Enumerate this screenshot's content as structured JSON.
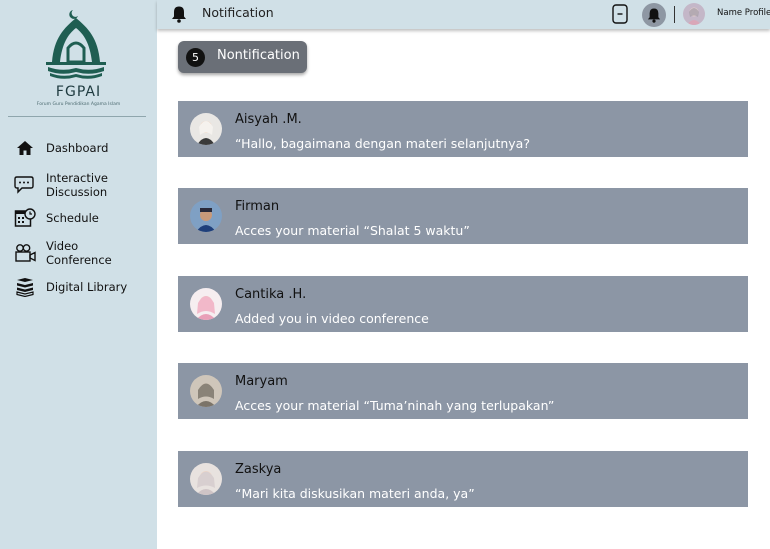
{
  "brand": {
    "name": "FGPAI",
    "tagline": "Forum Guru Pendidikan Agama Islam"
  },
  "sidebar": {
    "items": [
      {
        "label": "Dashboard",
        "icon": "home-icon"
      },
      {
        "label": "Interactive Discussion",
        "icon": "chat-bubbles-icon"
      },
      {
        "label": "Schedule",
        "icon": "calendar-clock-icon"
      },
      {
        "label": "Video Conference",
        "icon": "video-camera-icon"
      },
      {
        "label": "Digital Library",
        "icon": "books-icon"
      }
    ]
  },
  "topbar": {
    "title": "Notification",
    "profile_name": "Name Profile"
  },
  "notifications_button": {
    "count": "5",
    "label": "Nontification"
  },
  "notifications": [
    {
      "name": "Aisyah .M.",
      "message": "“Hallo, bagaimana dengan materi selanjutnya?"
    },
    {
      "name": "Firman",
      "message": "Acces your material “Shalat 5 waktu”"
    },
    {
      "name": "Cantika .H.",
      "message": "Added you in video conference"
    },
    {
      "name": " Maryam",
      "message": "Acces your material “Tuma’ninah yang terlupakan”"
    },
    {
      "name": "Zaskya",
      "message": "“Mari kita diskusikan materi anda, ya”"
    }
  ],
  "colors": {
    "sidebar_bg": "#d0e0e7",
    "card_bg": "#8c96a5",
    "brand_green": "#1f5e52"
  }
}
